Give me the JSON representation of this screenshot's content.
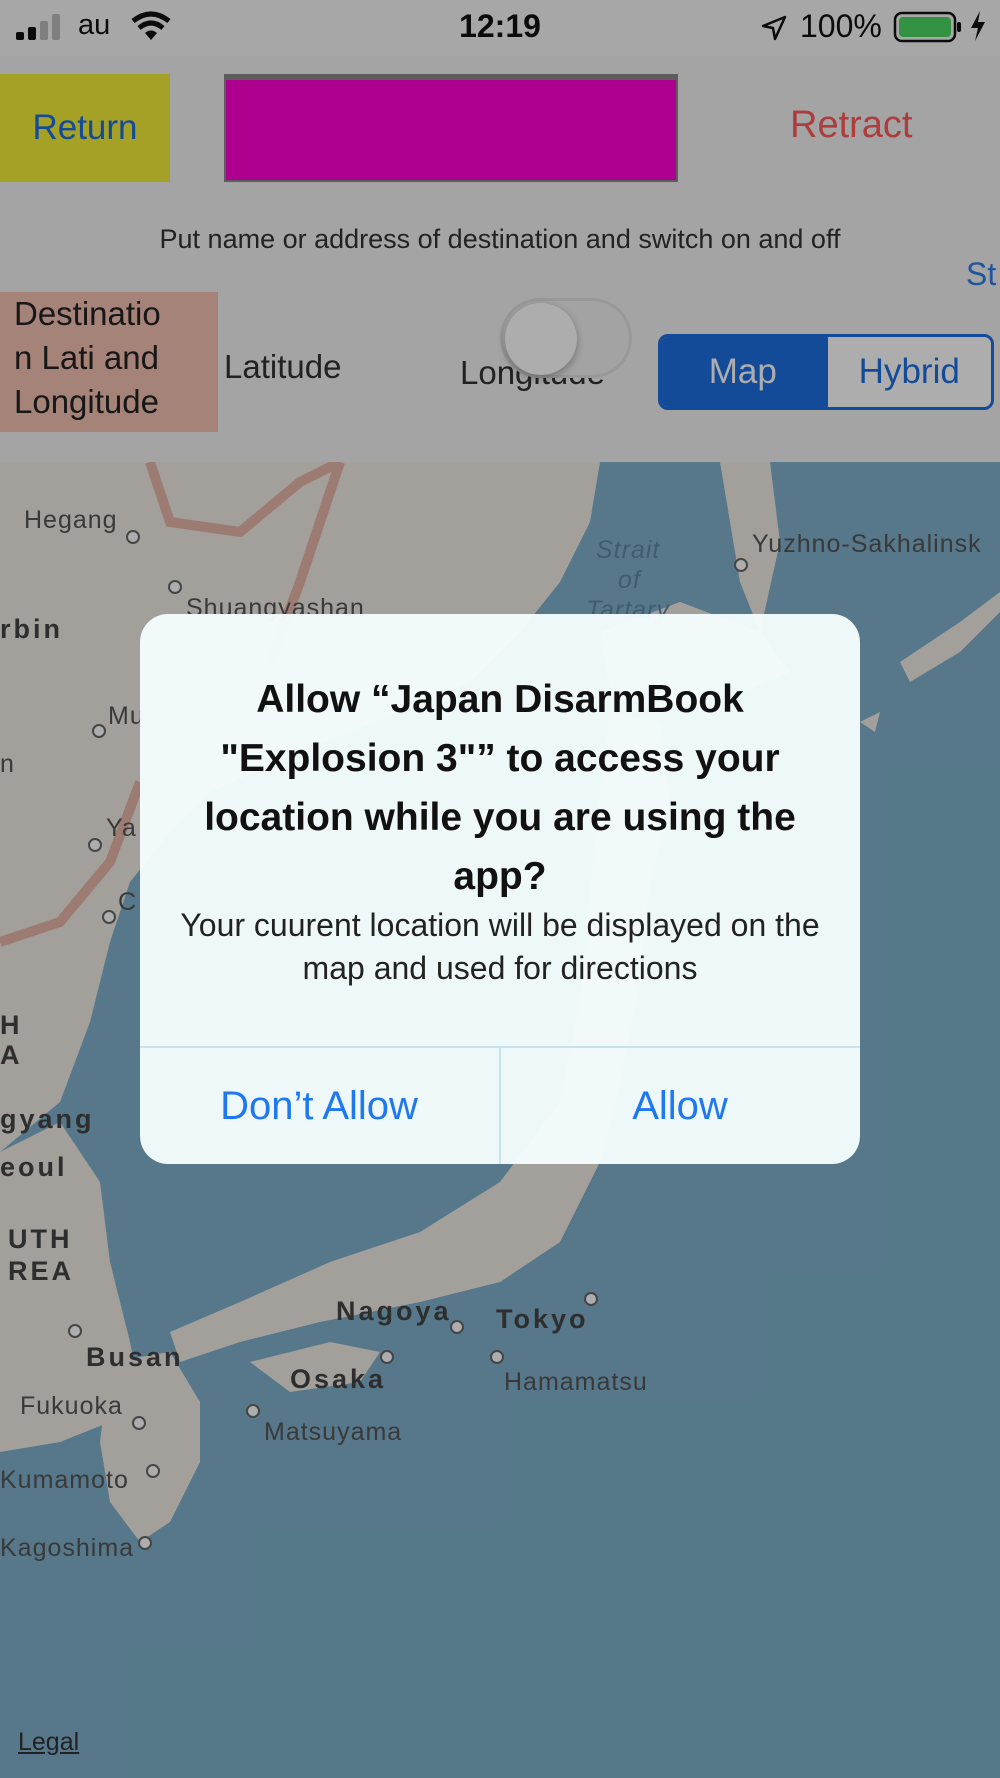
{
  "status_bar": {
    "carrier": "au",
    "time": "12:19",
    "battery": "100%"
  },
  "controls": {
    "return_label": "Return",
    "retract_label": "Retract",
    "hint": "Put name or address of destination and switch on and off",
    "st_label": "St",
    "destination_label": "Destinatio\nn Lati and\nLongitude",
    "latitude_label": "Latitude",
    "longitude_label": "Longitude",
    "map_type": {
      "options": [
        "Map",
        "Hybrid"
      ],
      "selected": "Map"
    },
    "toggle_on": false
  },
  "map": {
    "places": {
      "hegang": "Hegang",
      "yuzhno": "Yuzhno-Sakhalinsk",
      "strait1": "Strait",
      "strait2": "of",
      "strait3": "Tartary",
      "shuangyashan": "Shuangyashan",
      "harbin": "rbin",
      "mu": "Mu",
      "n": "n",
      "ya": "Ya",
      "c": "C",
      "h": "H",
      "a": "A",
      "pyongyang": "gyang",
      "seoul": "eoul",
      "south1": "UTH",
      "south2": "REA",
      "nagoya": "Nagoya",
      "tokyo": "Tokyo",
      "busan": "Busan",
      "osaka": "Osaka",
      "hamamatsu": "Hamamatsu",
      "fukuoka": "Fukuoka",
      "matsuyama": "Matsuyama",
      "kumamoto": "Kumamoto",
      "kagoshima": "Kagoshima"
    },
    "legal": "Legal"
  },
  "alert": {
    "title": "Allow “Japan DisarmBook \"Explosion 3\"” to access your location while you are using the app?",
    "message": "Your cuurent location will be displayed on the map and used for directions",
    "deny_label": "Don’t Allow",
    "allow_label": "Allow"
  },
  "colors": {
    "return_bg": "#f4ec39",
    "magenta_box": "#ff00d2",
    "retract_text": "#ff5b5b",
    "accent_blue": "#1d6fe0",
    "destination_bg": "#f5c1b3",
    "water": "#7fb2cc",
    "land": "#f0ece6"
  }
}
